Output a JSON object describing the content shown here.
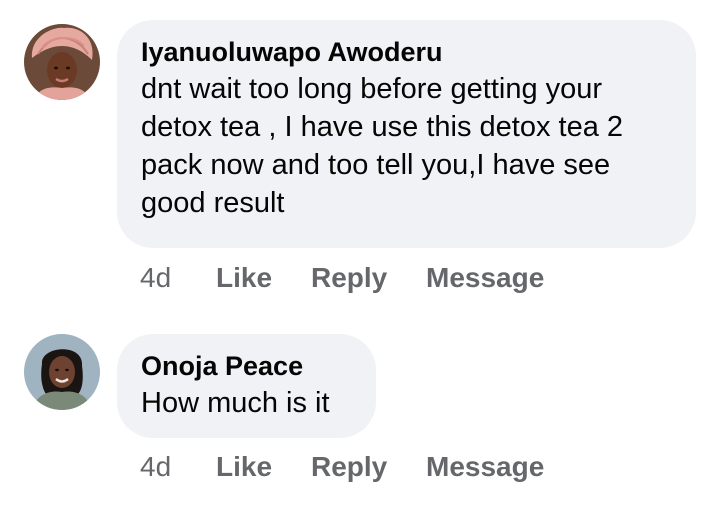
{
  "comments": [
    {
      "author": "Iyanuoluwapo Awoderu",
      "lines": [
        "dnt wait too long before getting your",
        "detox tea , I have use this detox tea 2",
        "pack now and too tell you,I have see",
        "good result"
      ],
      "time": "4d",
      "like_label": "Like",
      "reply_label": "Reply",
      "message_label": "Message"
    },
    {
      "author": "Onoja Peace",
      "lines": [
        "How much is it"
      ],
      "time": "4d",
      "like_label": "Like",
      "reply_label": "Reply",
      "message_label": "Message"
    }
  ],
  "colors": {
    "bubble_bg": "#f0f2f5",
    "action_text": "#65676b",
    "primary_text": "#050505"
  }
}
